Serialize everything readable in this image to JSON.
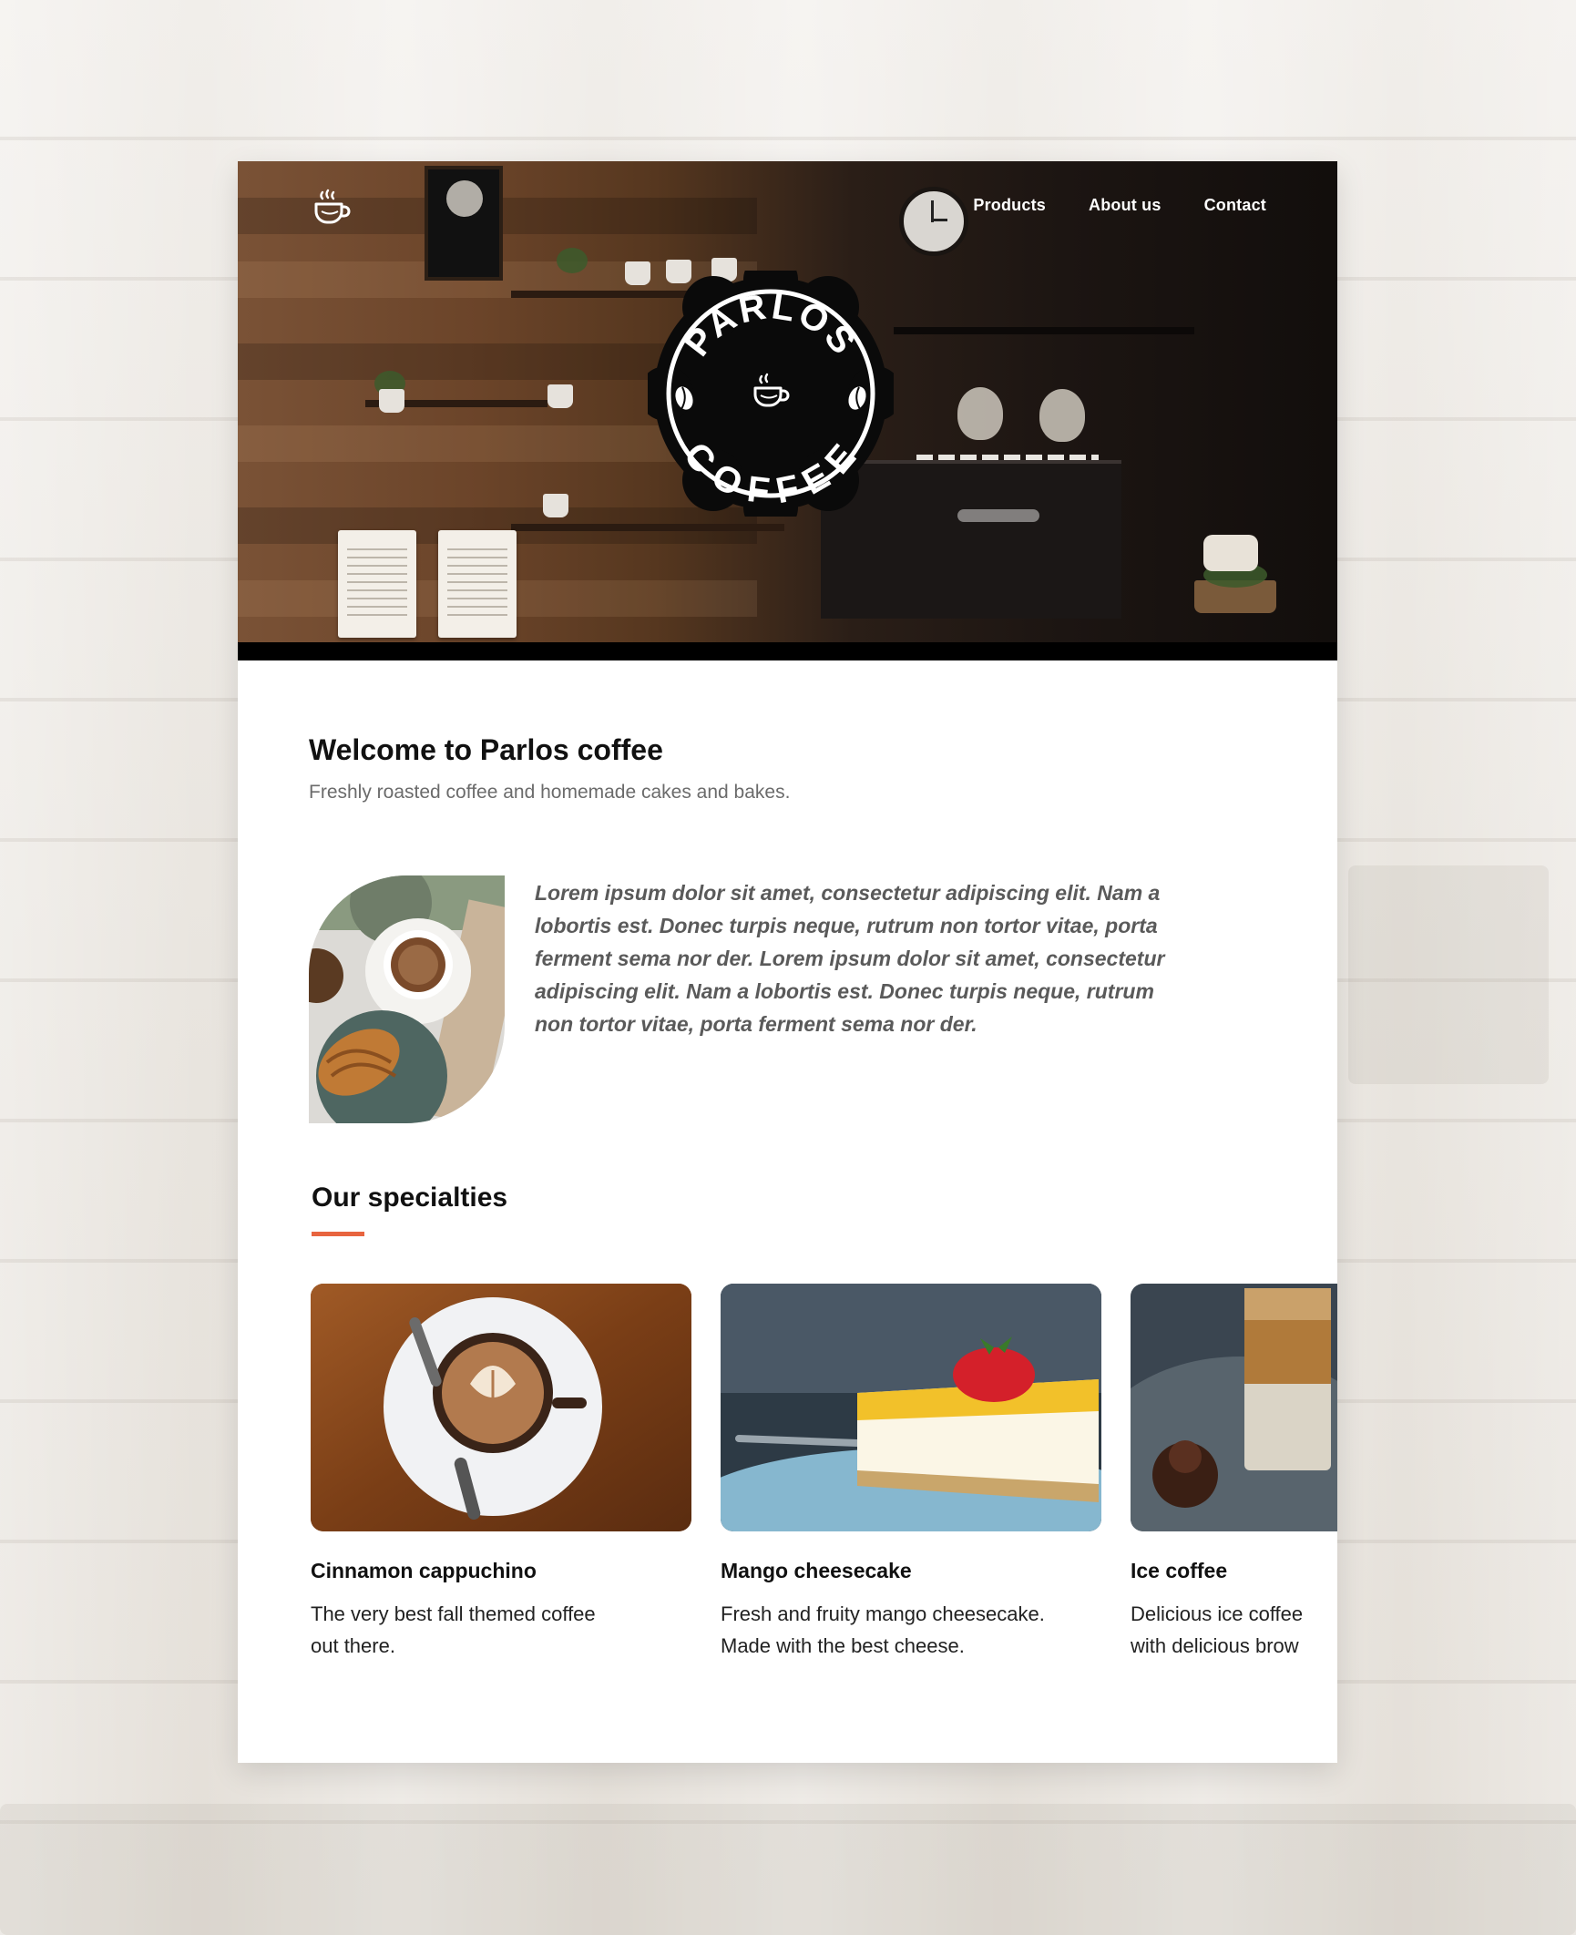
{
  "nav": {
    "items": [
      {
        "label": "Products"
      },
      {
        "label": "About us"
      },
      {
        "label": "Contact"
      }
    ]
  },
  "logo": {
    "top": "PARLOS",
    "bottom": "COFFEE",
    "icon": "coffee-cup-icon"
  },
  "welcome": {
    "title": "Welcome to Parlos coffee",
    "subtitle": "Freshly roasted coffee and homemade cakes and bakes."
  },
  "intro": {
    "text": "Lorem ipsum dolor sit amet, consectetur adipiscing elit. Nam a lobortis est. Donec turpis neque, rutrum non tortor vitae, porta ferment sema nor der. Lorem ipsum dolor sit amet, consectetur adipiscing elit. Nam a lobortis est. Donec turpis neque, rutrum non tortor vitae, porta ferment sema nor der."
  },
  "specialties": {
    "title": "Our specialties",
    "items": [
      {
        "name": "Cinnamon cappuchino",
        "desc": "The very best fall themed coffee\nout there."
      },
      {
        "name": "Mango cheesecake",
        "desc": "Fresh and fruity mango cheesecake.\nMade with the best cheese."
      },
      {
        "name": "Ice coffee",
        "desc": "Delicious ice coffee\nwith delicious brow"
      }
    ]
  },
  "colors": {
    "accent": "#e8643f",
    "text": "#111111",
    "muted": "#6b6b6b"
  }
}
